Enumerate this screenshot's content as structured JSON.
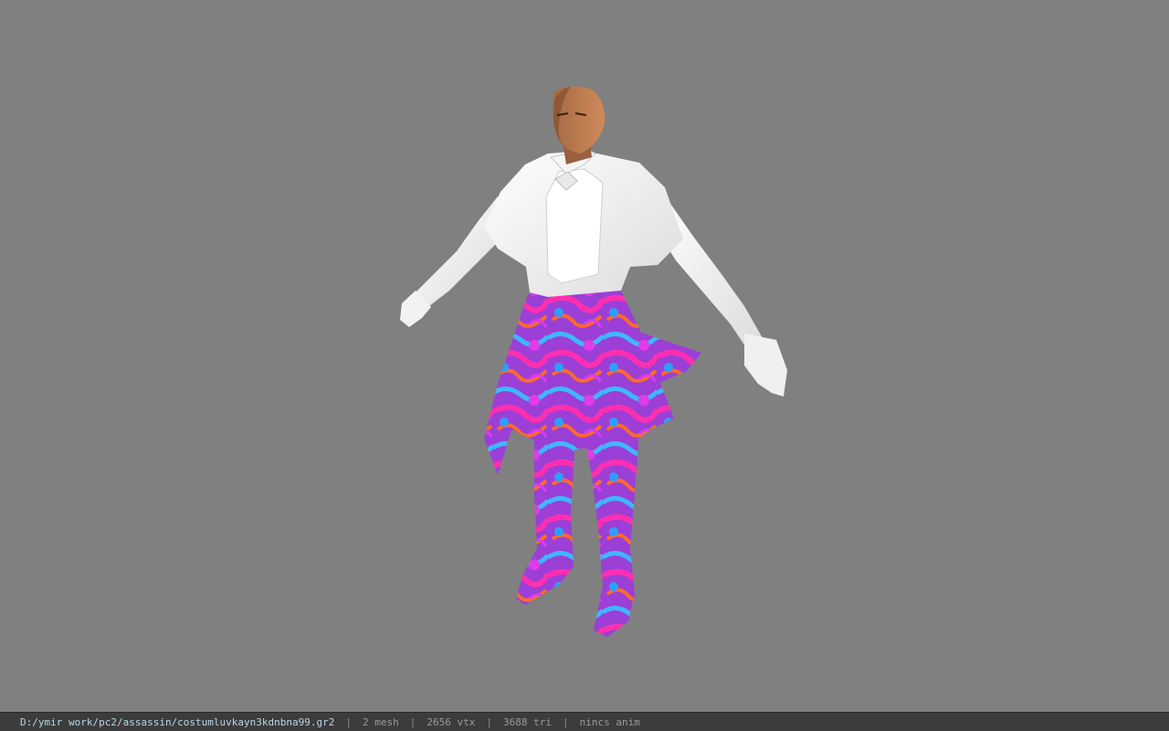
{
  "status": {
    "file_path": "D:/ymir work/pc2/assassin/costumluvkayn3kdnbna99.gr2",
    "separator": "|",
    "mesh_count": "2 mesh",
    "vertex_count": "2656 vtx",
    "triangle_count": "3688 tri",
    "animation": "nincs anim"
  },
  "colors": {
    "background": "#808080",
    "statusbar": "#3c3c3c",
    "path_text": "#b9d8e6",
    "info_text": "#9a9a9a"
  }
}
